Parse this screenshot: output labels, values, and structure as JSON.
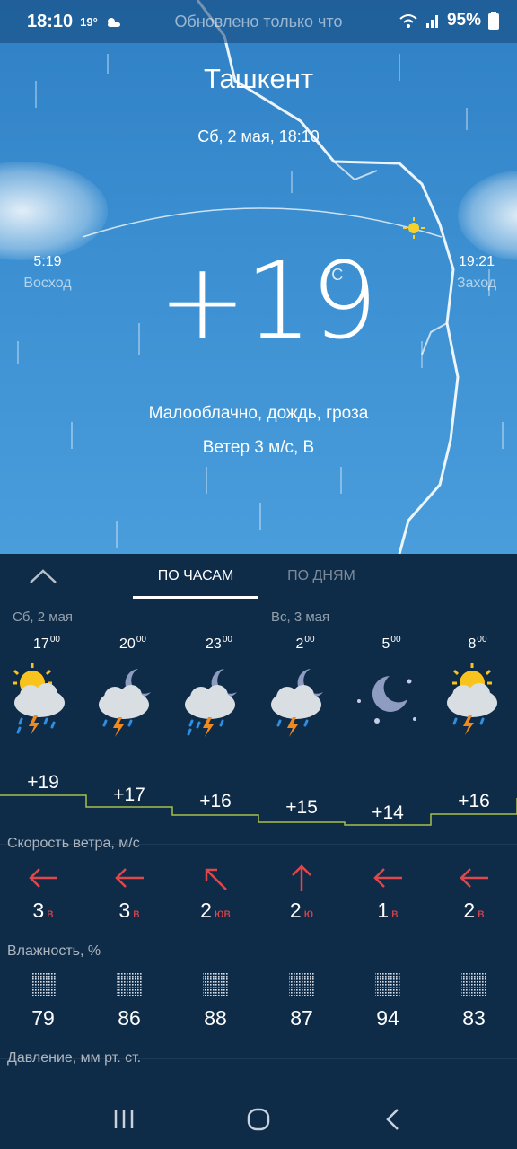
{
  "status": {
    "time": "18:10",
    "temp": "19°",
    "updated": "Обновлено только что",
    "battery": "95%"
  },
  "location": {
    "city": "Ташкент",
    "date": "Сб, 2 мая, 18:10"
  },
  "sun": {
    "sunrise_time": "5:19",
    "sunrise_label": "Восход",
    "sunset_time": "19:21",
    "sunset_label": "Заход"
  },
  "current": {
    "temperature": "+19",
    "unit": "°C",
    "condition": "Малооблачно, дождь, гроза",
    "wind": "Ветер 3 м/с, В"
  },
  "tabs": {
    "hourly": "По часам",
    "daily": "По дням"
  },
  "day_headers": {
    "day1": "Сб, 2 мая",
    "day2": "Вс, 3 мая"
  },
  "hourly": [
    {
      "hour": "17",
      "min": "00",
      "icon": "sun-cloud-storm-icon",
      "temp": "+19",
      "wind_speed": "3",
      "wind_dir": "в",
      "wind_arrow": "arrow-left-icon",
      "humidity": "79"
    },
    {
      "hour": "20",
      "min": "00",
      "icon": "moon-cloud-storm-icon",
      "temp": "+17",
      "wind_speed": "3",
      "wind_dir": "в",
      "wind_arrow": "arrow-left-icon",
      "humidity": "86"
    },
    {
      "hour": "23",
      "min": "00",
      "icon": "moon-cloud-storm-icon",
      "temp": "+16",
      "wind_speed": "2",
      "wind_dir": "юв",
      "wind_arrow": "arrow-up-left-icon",
      "humidity": "88"
    },
    {
      "hour": "2",
      "min": "00",
      "icon": "moon-cloud-storm-icon",
      "temp": "+15",
      "wind_speed": "2",
      "wind_dir": "ю",
      "wind_arrow": "arrow-up-icon",
      "humidity": "87"
    },
    {
      "hour": "5",
      "min": "00",
      "icon": "moon-stars-icon",
      "temp": "+14",
      "wind_speed": "1",
      "wind_dir": "в",
      "wind_arrow": "arrow-left-icon",
      "humidity": "94"
    },
    {
      "hour": "8",
      "min": "00",
      "icon": "sun-cloud-storm-icon",
      "temp": "+16",
      "wind_speed": "2",
      "wind_dir": "в",
      "wind_arrow": "arrow-left-icon",
      "humidity": "83"
    }
  ],
  "sections": {
    "wind": "Скорость ветра, м/с",
    "humidity": "Влажность, %",
    "pressure": "Давление, мм рт. ст."
  },
  "colors": {
    "sky": "#3a8ed0",
    "panel": "#0e2b47",
    "accent_red": "#e0474b",
    "temp_line": "#a7c04a"
  }
}
